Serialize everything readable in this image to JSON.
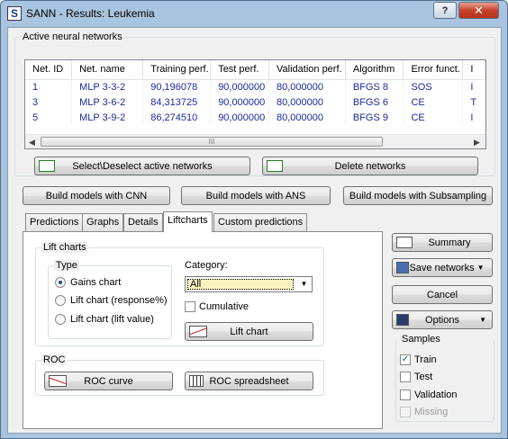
{
  "window": {
    "title": "SANN - Results: Leukemia",
    "help_label": "?",
    "close_label": "✕"
  },
  "networks": {
    "group_label": "Active neural networks",
    "columns": [
      "Net. ID",
      "Net. name",
      "Training perf.",
      "Test perf.",
      "Validation perf.",
      "Algorithm",
      "Error funct.",
      "I"
    ],
    "rows": [
      [
        "1",
        "MLP 3-3-2",
        "90,196078",
        "90,000000",
        "80,000000",
        "BFGS 8",
        "SOS",
        "I"
      ],
      [
        "3",
        "MLP 3-6-2",
        "84,313725",
        "90,000000",
        "80,000000",
        "BFGS 6",
        "CE",
        "T"
      ],
      [
        "5",
        "MLP 3-9-2",
        "86,274510",
        "90,000000",
        "80,000000",
        "BFGS 9",
        "CE",
        "I"
      ]
    ],
    "scroll_grip": "III",
    "select_button": "Select\\Deselect active networks",
    "delete_button": "Delete networks"
  },
  "build": {
    "cnn": "Build models with CNN",
    "ans": "Build models with ANS",
    "subsampling": "Build models with Subsampling"
  },
  "tabs": [
    "Predictions",
    "Graphs",
    "Details",
    "Liftcharts",
    "Custom predictions"
  ],
  "active_tab": "Liftcharts",
  "lift": {
    "group_label": "Lift charts",
    "type_label": "Type",
    "options": [
      "Gains chart",
      "Lift chart (response%)",
      "Lift chart (lift value)"
    ],
    "selected": "Gains chart",
    "category_label": "Category:",
    "category_value": "All",
    "cumulative_label": "Cumulative",
    "cumulative_checked": false,
    "lift_chart_button": "Lift chart"
  },
  "roc": {
    "group_label": "ROC",
    "curve_button": "ROC curve",
    "spreadsheet_button": "ROC spreadsheet"
  },
  "side": {
    "summary": "Summary",
    "save_networks": "Save networks",
    "cancel": "Cancel",
    "options": "Options"
  },
  "samples": {
    "group_label": "Samples",
    "items": [
      {
        "label": "Train",
        "checked": true,
        "enabled": true
      },
      {
        "label": "Test",
        "checked": false,
        "enabled": true
      },
      {
        "label": "Validation",
        "checked": false,
        "enabled": true
      },
      {
        "label": "Missing",
        "checked": false,
        "enabled": false
      }
    ]
  },
  "colors": {
    "title_bar": "#a9c4de",
    "grid_text": "#1c2a9c",
    "close_button": "#c7432b"
  }
}
